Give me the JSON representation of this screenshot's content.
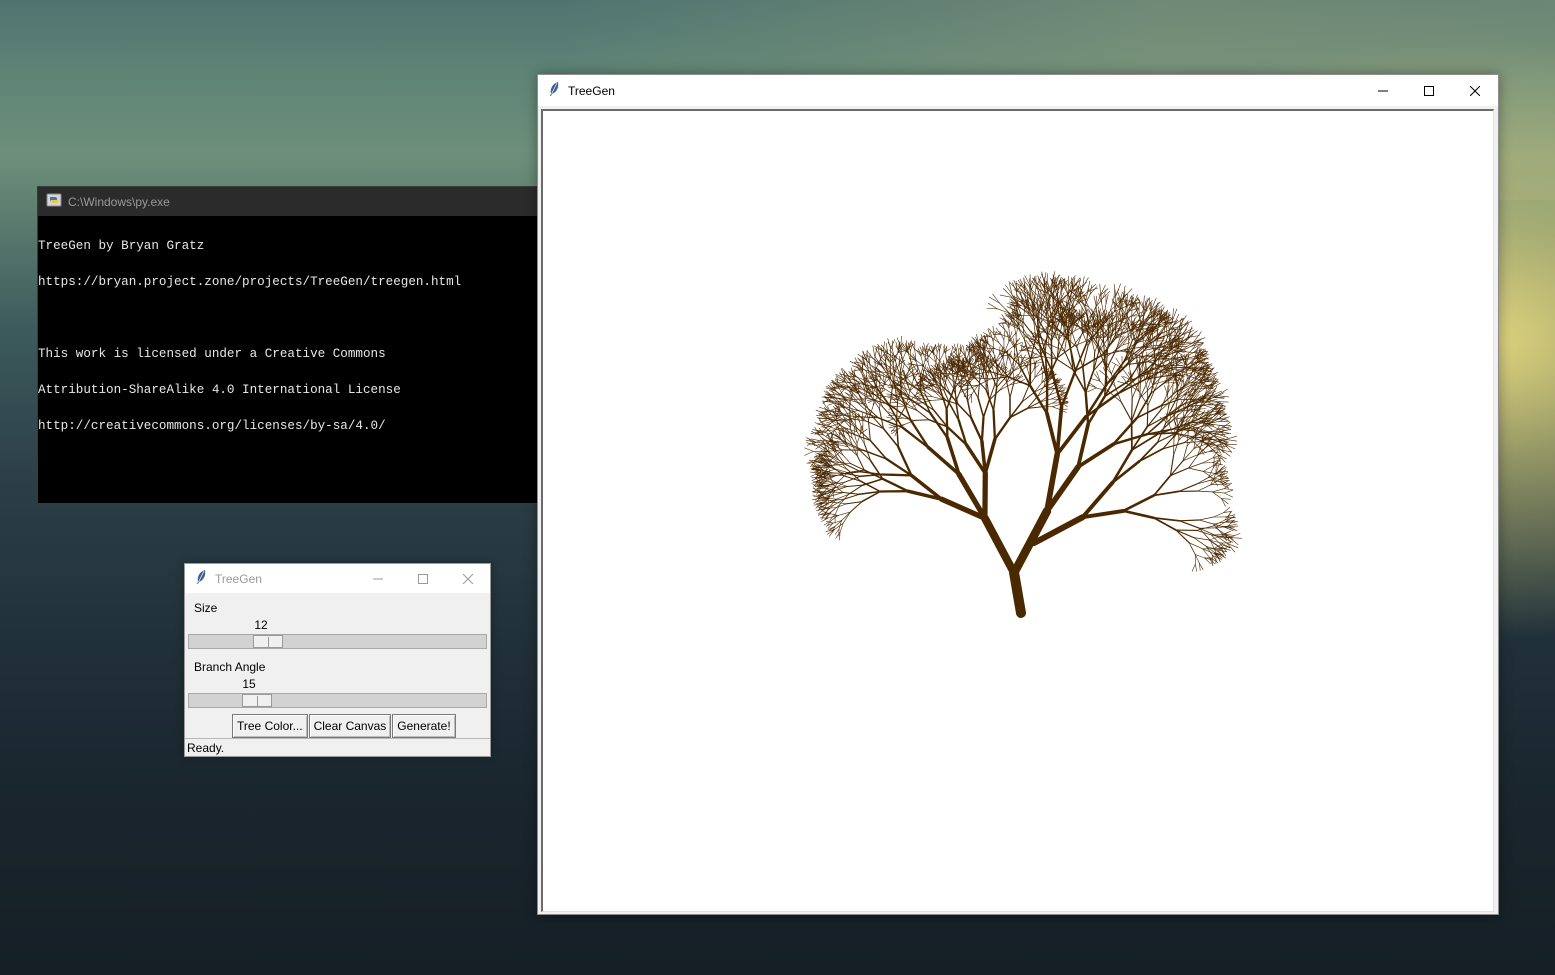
{
  "console": {
    "title": "C:\\Windows\\py.exe",
    "lines": [
      "TreeGen by Bryan Gratz",
      "https://bryan.project.zone/projects/TreeGen/treegen.html",
      "",
      "This work is licensed under a Creative Commons",
      "Attribution-ShareAlike 4.0 International License",
      "http://creativecommons.org/licenses/by-sa/4.0/"
    ]
  },
  "main_window": {
    "title": "TreeGen",
    "icon": "feather-icon",
    "tree_color": "#4a2800"
  },
  "control_window": {
    "title": "TreeGen",
    "icon": "feather-icon",
    "size": {
      "label": "Size",
      "value": "12",
      "fraction": 0.24
    },
    "branch_angle": {
      "label": "Branch Angle",
      "value": "15",
      "fraction": 0.2
    },
    "buttons": {
      "tree_color": "Tree Color...",
      "clear_canvas": "Clear Canvas",
      "generate": "Generate!"
    },
    "status": "Ready."
  }
}
